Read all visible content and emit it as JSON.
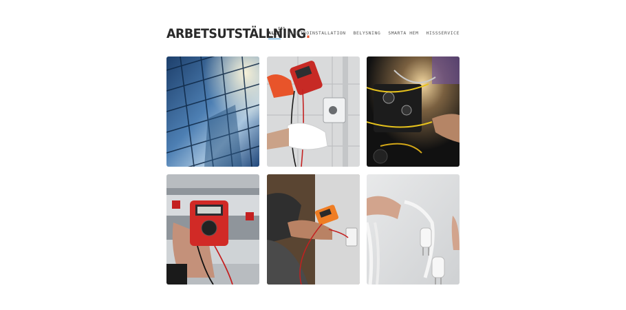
{
  "header": {
    "logo_text": "ARBETSUTSTÄLLNING",
    "logo_dot": ".",
    "accent_color": "#e8542a"
  },
  "filters": [
    {
      "label": "ALLT",
      "count": "[6]",
      "active": true
    },
    {
      "label": "ELEKTROINSTALLATION",
      "active": false
    },
    {
      "label": "BELYSNING",
      "active": false
    },
    {
      "label": "SMARTA HEM",
      "active": false
    },
    {
      "label": "HISSSERVICE",
      "active": false
    }
  ],
  "gallery": {
    "items": [
      {
        "subject": "glass-skyscraper-facade"
      },
      {
        "subject": "multimeter-on-wall-socket"
      },
      {
        "subject": "electrical-panel-wiring"
      },
      {
        "subject": "multimeter-testing-battery"
      },
      {
        "subject": "electrician-testing-outlet"
      },
      {
        "subject": "hands-holding-power-plug"
      }
    ]
  },
  "colors": {
    "filter_underline": "#3a9ad9",
    "text": "#2a2a2a"
  }
}
